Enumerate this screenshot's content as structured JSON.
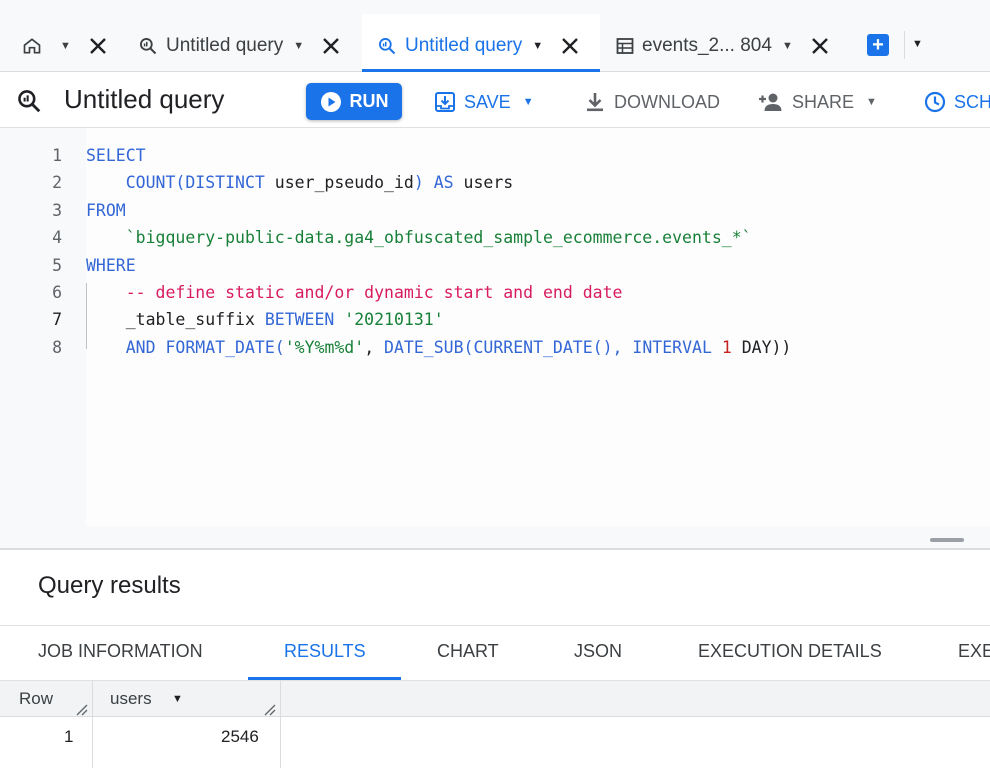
{
  "tabs": [
    {
      "label": "Untitled query"
    },
    {
      "label": "Untitled query"
    },
    {
      "label": "events_2... 804"
    }
  ],
  "toolbar": {
    "title": "Untitled query",
    "run_label": "RUN",
    "save_label": "SAVE",
    "download_label": "DOWNLOAD",
    "share_label": "SHARE",
    "schedule_label": "SCH"
  },
  "editor": {
    "lines": [
      {
        "num": "1",
        "tokens": [
          {
            "t": "SELECT",
            "c": "kw"
          }
        ]
      },
      {
        "num": "2",
        "tokens": [
          {
            "t": "    ",
            "c": "pl"
          },
          {
            "t": "COUNT(DISTINCT",
            "c": "kw"
          },
          {
            "t": " user_pseudo_id",
            "c": "pl"
          },
          {
            "t": ")",
            "c": "kw"
          },
          {
            "t": " AS",
            "c": "kw"
          },
          {
            "t": " users",
            "c": "pl"
          }
        ]
      },
      {
        "num": "3",
        "tokens": [
          {
            "t": "FROM",
            "c": "kw"
          }
        ]
      },
      {
        "num": "4",
        "tokens": [
          {
            "t": "    ",
            "c": "pl"
          },
          {
            "t": "`bigquery-public-data.ga4_obfuscated_sample_ecommerce.events_*`",
            "c": "str"
          }
        ]
      },
      {
        "num": "5",
        "tokens": [
          {
            "t": "WHERE",
            "c": "kw"
          }
        ]
      },
      {
        "num": "6",
        "tokens": [
          {
            "t": "    ",
            "c": "pl"
          },
          {
            "t": "-- define static and/or dynamic start and end date",
            "c": "cmt"
          }
        ]
      },
      {
        "num": "7",
        "tokens": [
          {
            "t": "    ",
            "c": "pl"
          },
          {
            "t": "_table_suffix",
            "c": "pl"
          },
          {
            "t": " BETWEEN",
            "c": "kw"
          },
          {
            "t": " '20210131'",
            "c": "str"
          }
        ]
      },
      {
        "num": "8",
        "tokens": [
          {
            "t": "    ",
            "c": "pl"
          },
          {
            "t": "AND",
            "c": "kw"
          },
          {
            "t": " FORMAT_DATE(",
            "c": "kw"
          },
          {
            "t": "'%Y%m%d'",
            "c": "str"
          },
          {
            "t": ",",
            "c": "pl"
          },
          {
            "t": " DATE_SUB(CURRENT_DATE(),",
            "c": "kw"
          },
          {
            "t": " INTERVAL",
            "c": "kw"
          },
          {
            "t": " 1",
            "c": "num"
          },
          {
            "t": " DAY))",
            "c": "pl"
          }
        ]
      }
    ]
  },
  "results": {
    "title": "Query results",
    "tabs": [
      "JOB INFORMATION",
      "RESULTS",
      "CHART",
      "JSON",
      "EXECUTION DETAILS",
      "EXE"
    ],
    "columns": [
      "Row",
      "users"
    ],
    "rows": [
      [
        "1",
        "2546"
      ]
    ]
  },
  "colors": {
    "accent": "#1a73e8",
    "keyword": "#3367d6",
    "string": "#188038",
    "comment": "#d81b60",
    "number": "#c5221f"
  }
}
